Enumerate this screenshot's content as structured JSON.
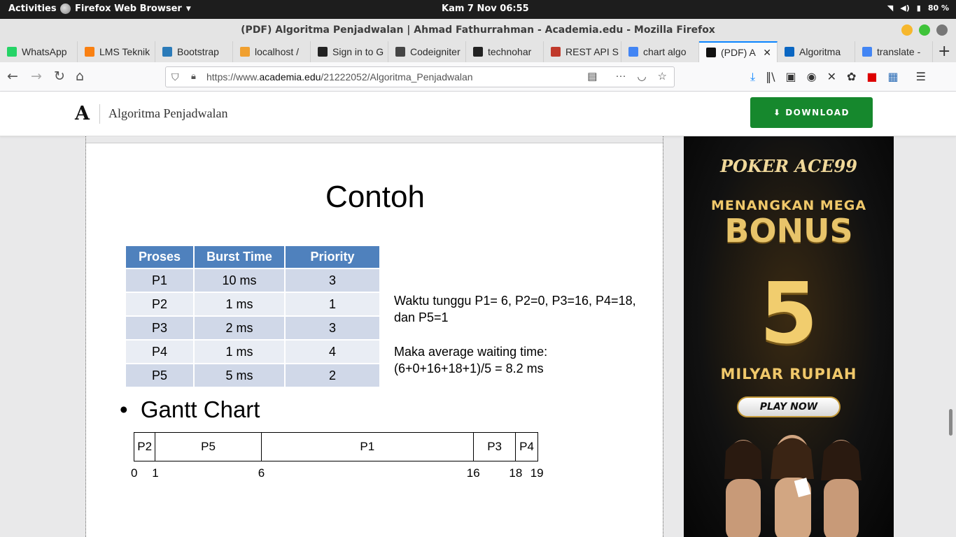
{
  "system": {
    "activities": "Activities",
    "app_name": "Firefox Web Browser",
    "clock": "Kam  7 Nov  06:55",
    "battery": "80 %"
  },
  "window": {
    "title": "(PDF) Algoritma Penjadwalan | Ahmad Fathurrahman - Academia.edu - Mozilla Firefox"
  },
  "tabs": [
    {
      "label": "WhatsApp",
      "icon": "whatsapp-icon",
      "color": "#25d366"
    },
    {
      "label": "LMS Teknik",
      "icon": "moodle-icon",
      "color": "#f98012"
    },
    {
      "label": "Bootstrap",
      "icon": "bootstrap-icon",
      "color": "#2b7bb9"
    },
    {
      "label": "localhost /",
      "icon": "phpmyadmin-icon",
      "color": "#f0a030"
    },
    {
      "label": "Sign in to G",
      "icon": "github-icon",
      "color": "#222222"
    },
    {
      "label": "Codeigniter",
      "icon": "codeigniter-icon",
      "color": "#444444"
    },
    {
      "label": "technohar",
      "icon": "github-icon",
      "color": "#222222"
    },
    {
      "label": "REST API S",
      "icon": "rest-icon",
      "color": "#c0392b"
    },
    {
      "label": "chart algo",
      "icon": "google-icon",
      "color": "#4285f4"
    },
    {
      "label": "(PDF) A",
      "icon": "academia-icon",
      "color": "#111111"
    },
    {
      "label": "Algoritma",
      "icon": "linkedin-icon",
      "color": "#0a66c2"
    },
    {
      "label": "translate -",
      "icon": "google-icon",
      "color": "#4285f4"
    }
  ],
  "urlbar": {
    "prefix": "https://www.",
    "host": "academia.edu",
    "path": "/21222052/Algoritma_Penjadwalan"
  },
  "header": {
    "logo": "A",
    "title": "Algoritma Penjadwalan",
    "download_label": "DOWNLOAD"
  },
  "slide": {
    "title": "Contoh",
    "columns": [
      "Proses",
      "Burst Time",
      "Priority"
    ],
    "rows": [
      [
        "P1",
        "10 ms",
        "3"
      ],
      [
        "P2",
        "1 ms",
        "1"
      ],
      [
        "P3",
        "2 ms",
        "3"
      ],
      [
        "P4",
        "1 ms",
        "4"
      ],
      [
        "P5",
        "5 ms",
        "2"
      ]
    ],
    "wait_line1": "Waktu tunggu P1= 6, P2=0, P3=16, P4=18, dan P5=1",
    "wait_line2": "Maka average waiting time:",
    "wait_line3": "(6+0+16+18+1)/5 = 8.2 ms",
    "bullet": "Gantt Chart",
    "gantt": [
      {
        "label": "P2",
        "start": 0,
        "end": 1
      },
      {
        "label": "P5",
        "start": 1,
        "end": 6
      },
      {
        "label": "P1",
        "start": 6,
        "end": 16
      },
      {
        "label": "P3",
        "start": 16,
        "end": 18
      },
      {
        "label": "P4",
        "start": 18,
        "end": 19
      }
    ],
    "gantt_ticks": [
      "0",
      "1",
      "6",
      "16",
      "18",
      "19"
    ]
  },
  "ad": {
    "brand": "POKER ACE99",
    "line1": "MENANGKAN MEGA",
    "line2": "BONUS",
    "big": "5",
    "line3": "MILYAR RUPIAH",
    "cta": "PLAY NOW"
  }
}
